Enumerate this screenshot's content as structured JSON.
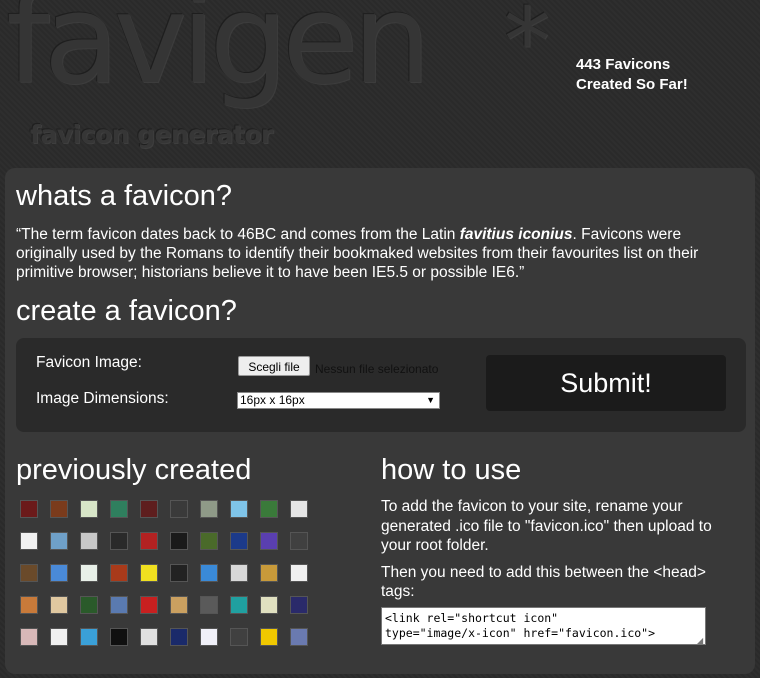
{
  "header": {
    "logo_text": "favigen",
    "logo_star": "*",
    "logo_sub": "favicon generator",
    "counter_line1": "443 Favicons",
    "counter_line2": "Created So Far!"
  },
  "whats": {
    "title": "whats a favicon?",
    "text_before": "“The term favicon dates back to 46BC and comes from the Latin ",
    "text_bold": "favitius iconius",
    "text_after": ". Favicons were originally used by the Romans to identify their bookmaked websites from their favourites list on their primitive browser; historians believe it to have been IE5.5 or possible IE6.”"
  },
  "create": {
    "title": "create a favicon?",
    "image_label": "Favicon Image:",
    "file_button": "Scegli file",
    "file_status": "Nessun file selezionato",
    "dimensions_label": "Image Dimensions:",
    "dimensions_value": "16px  x  16px",
    "submit": "Submit!"
  },
  "previous": {
    "title": "previously created",
    "icons": [
      "#6b1a1a",
      "#7a3b1c",
      "#d8e6c8",
      "#2f7f5e",
      "#5e1e1e",
      "#3a3a3a",
      "#8f9a88",
      "#7fc4e8",
      "#3a7a3a",
      "#e6e6e6",
      "#f2f2f2",
      "#6fa0c8",
      "#c8c8c8",
      "#2a2a2a",
      "#b22222",
      "#1a1a1a",
      "#4a6a2a",
      "#1c3a8a",
      "#5a3fb0",
      "#404040",
      "#6a4a2a",
      "#4a8ad8",
      "#e8f0e8",
      "#a83a1a",
      "#f0e020",
      "#222222",
      "#3a8ad8",
      "#d8d8d8",
      "#c89a3a",
      "#f0f0f0",
      "#c87a3a",
      "#e0c8a0",
      "#2a5a2a",
      "#5a7ab0",
      "#c82020",
      "#caa060",
      "#5a5a5a",
      "#20a0a0",
      "#e0e0c0",
      "#2a2a6a",
      "#d8b8b8",
      "#f0f0f0",
      "#3aa0d8",
      "#101010",
      "#e0e0e0",
      "#1a2a6a",
      "#f0f0f8",
      "#404040",
      "#f0c800",
      "#6a7ab0"
    ]
  },
  "howto": {
    "title": "how to use",
    "para1": "To add the favicon to your site, rename your generated .ico file to \"favicon.ico\" then upload to your root folder.",
    "para2": "Then you need to add this between the <head> tags:",
    "code": "<link rel=\"shortcut icon\"\ntype=\"image/x-icon\" href=\"favicon.ico\">"
  }
}
